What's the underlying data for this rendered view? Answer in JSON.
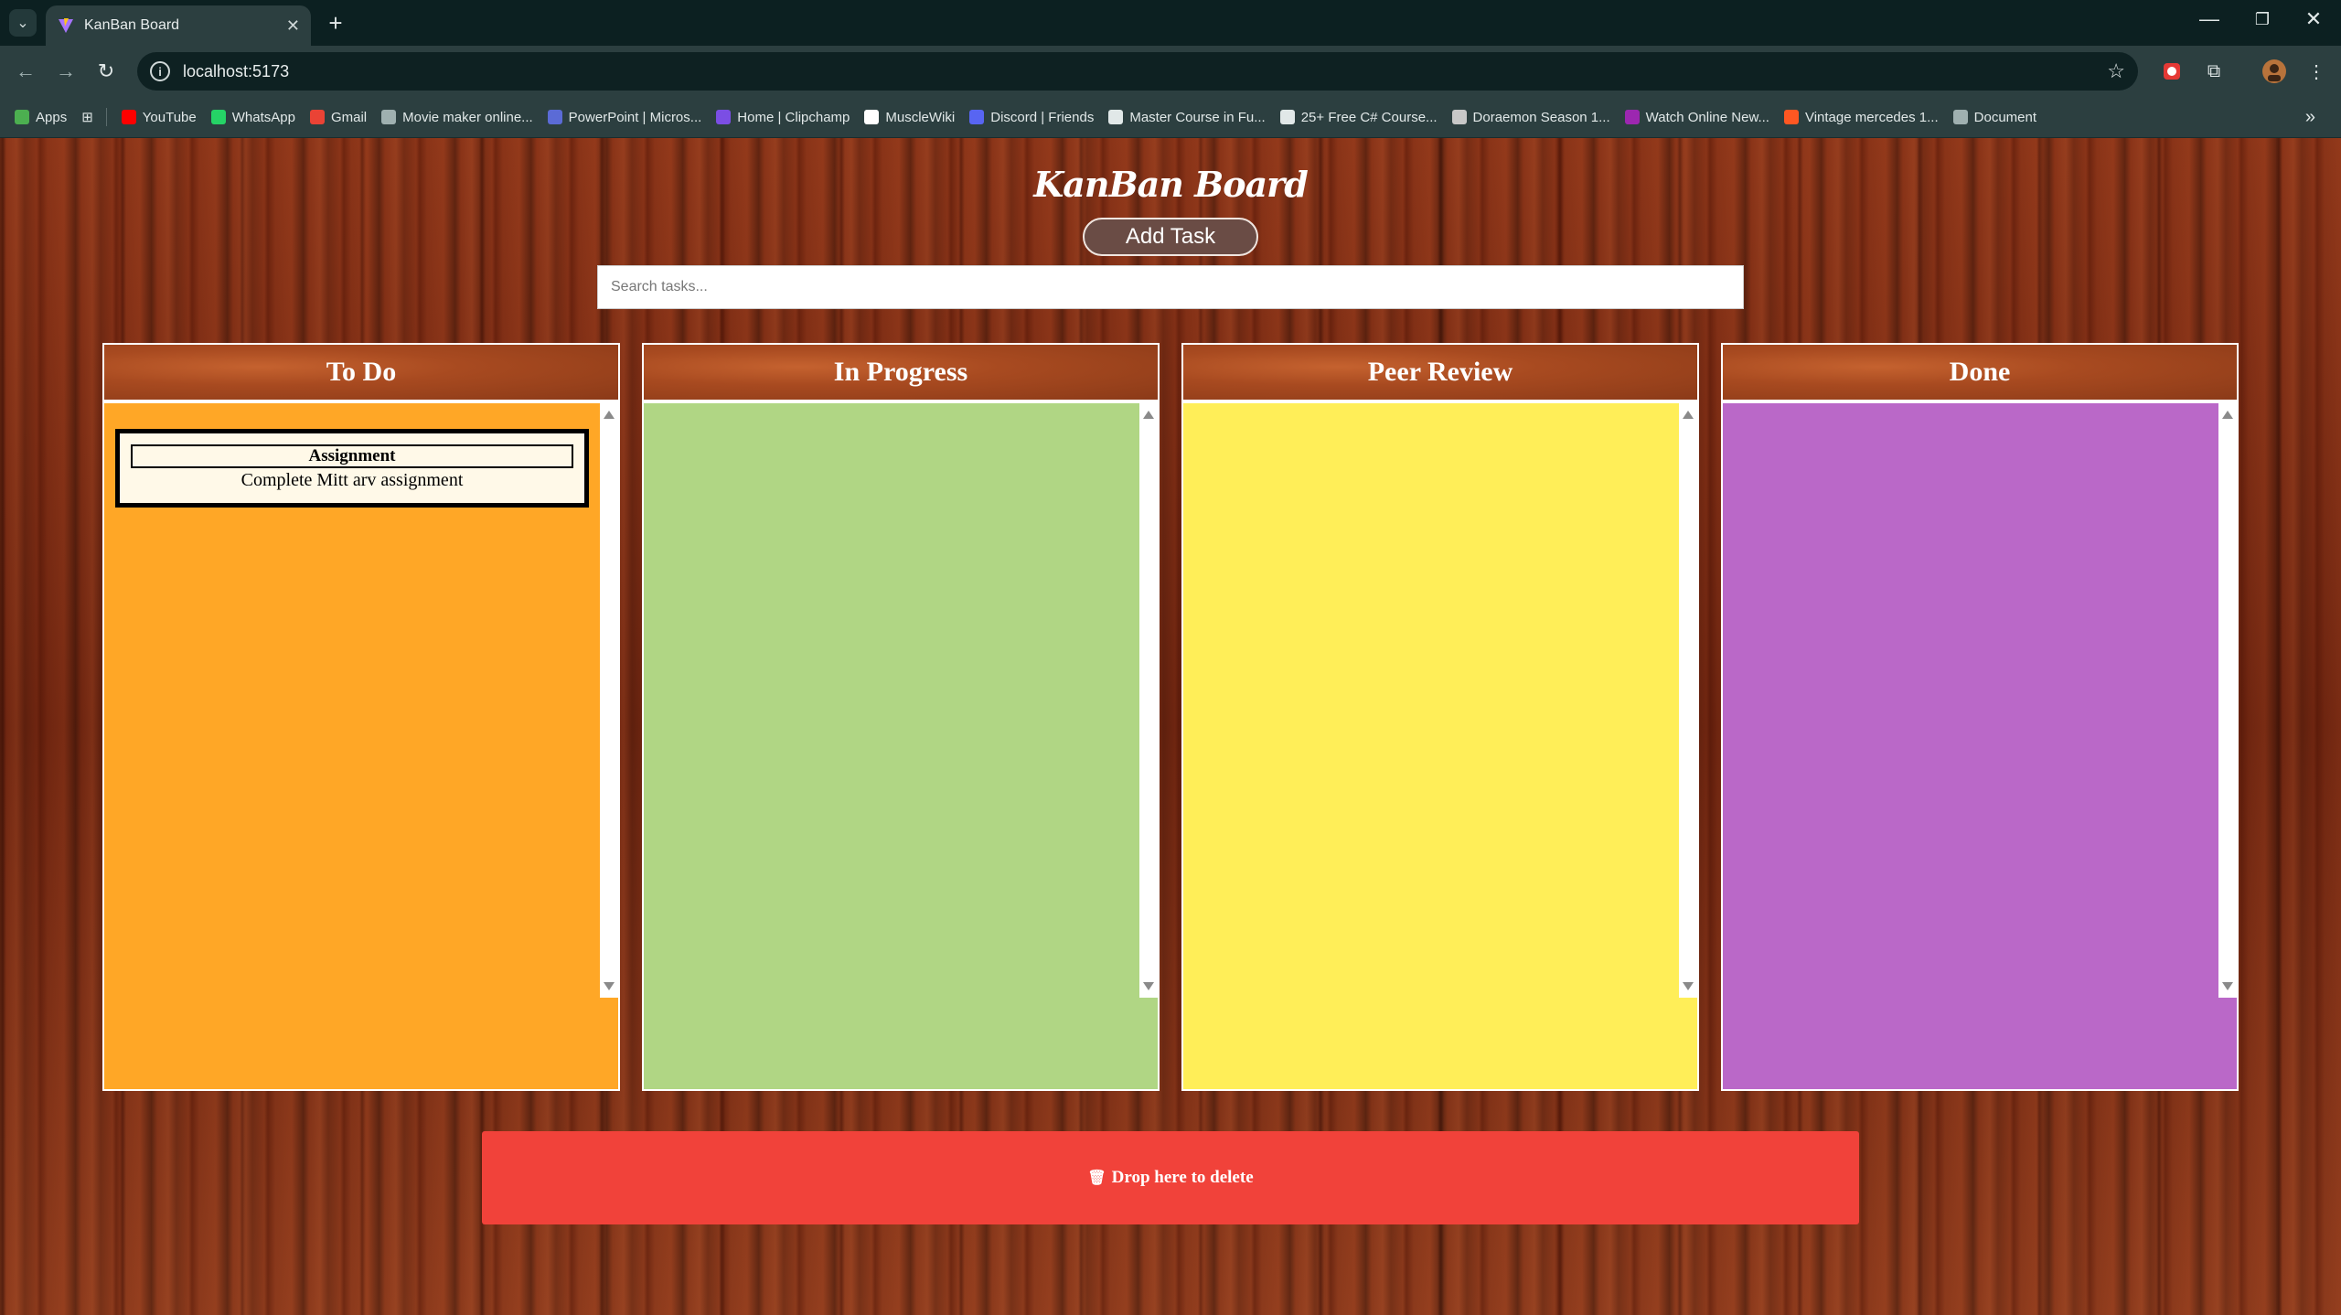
{
  "browser": {
    "tab_title": "KanBan Board",
    "url": "localhost:5173",
    "bookmarks": [
      {
        "label": "Apps",
        "icon": "apps-grid-icon",
        "color": "#4caf50"
      },
      {
        "label": "YouTube",
        "icon": "youtube-icon",
        "color": "#ff0000"
      },
      {
        "label": "WhatsApp",
        "icon": "whatsapp-icon",
        "color": "#25d366"
      },
      {
        "label": "Gmail",
        "icon": "gmail-icon",
        "color": "#ea4335"
      },
      {
        "label": "Movie maker online...",
        "icon": "globe-icon",
        "color": "#9fb0b0"
      },
      {
        "label": "PowerPoint | Micros...",
        "icon": "powerpoint-icon",
        "color": "#5b6bd6"
      },
      {
        "label": "Home | Clipchamp",
        "icon": "clipchamp-icon",
        "color": "#7b4ee4"
      },
      {
        "label": "MuscleWiki",
        "icon": "musclewiki-icon",
        "color": "#ffffff"
      },
      {
        "label": "Discord | Friends",
        "icon": "discord-icon",
        "color": "#5865f2"
      },
      {
        "label": "Master Course in Fu...",
        "icon": "google-icon",
        "color": "#e1e8e8"
      },
      {
        "label": "25+ Free C# Course...",
        "icon": "c-icon",
        "color": "#e1e8e8"
      },
      {
        "label": "Doraemon Season 1...",
        "icon": "doraemon-icon",
        "color": "#c8c8c8"
      },
      {
        "label": "Watch Online New...",
        "icon": "play-icon",
        "color": "#9c27b0"
      },
      {
        "label": "Vintage mercedes 1...",
        "icon": "flame-icon",
        "color": "#ff5722"
      },
      {
        "label": "Document",
        "icon": "globe-icon",
        "color": "#9fb0b0"
      }
    ]
  },
  "app": {
    "title": "KanBan Board",
    "add_task_label": "Add Task",
    "search_placeholder": "Search tasks...",
    "delete_zone_label": "Drop here to delete",
    "delete_icon": "trash-icon"
  },
  "columns": [
    {
      "name": "To Do",
      "color": "#ffa726",
      "tasks": [
        {
          "title": "Assignment",
          "description": "Complete Mitt arv assignment"
        }
      ]
    },
    {
      "name": "In Progress",
      "color": "#b0d684",
      "tasks": []
    },
    {
      "name": "Peer Review",
      "color": "#ffee58",
      "tasks": []
    },
    {
      "name": "Done",
      "color": "#ba68c8",
      "tasks": []
    }
  ]
}
